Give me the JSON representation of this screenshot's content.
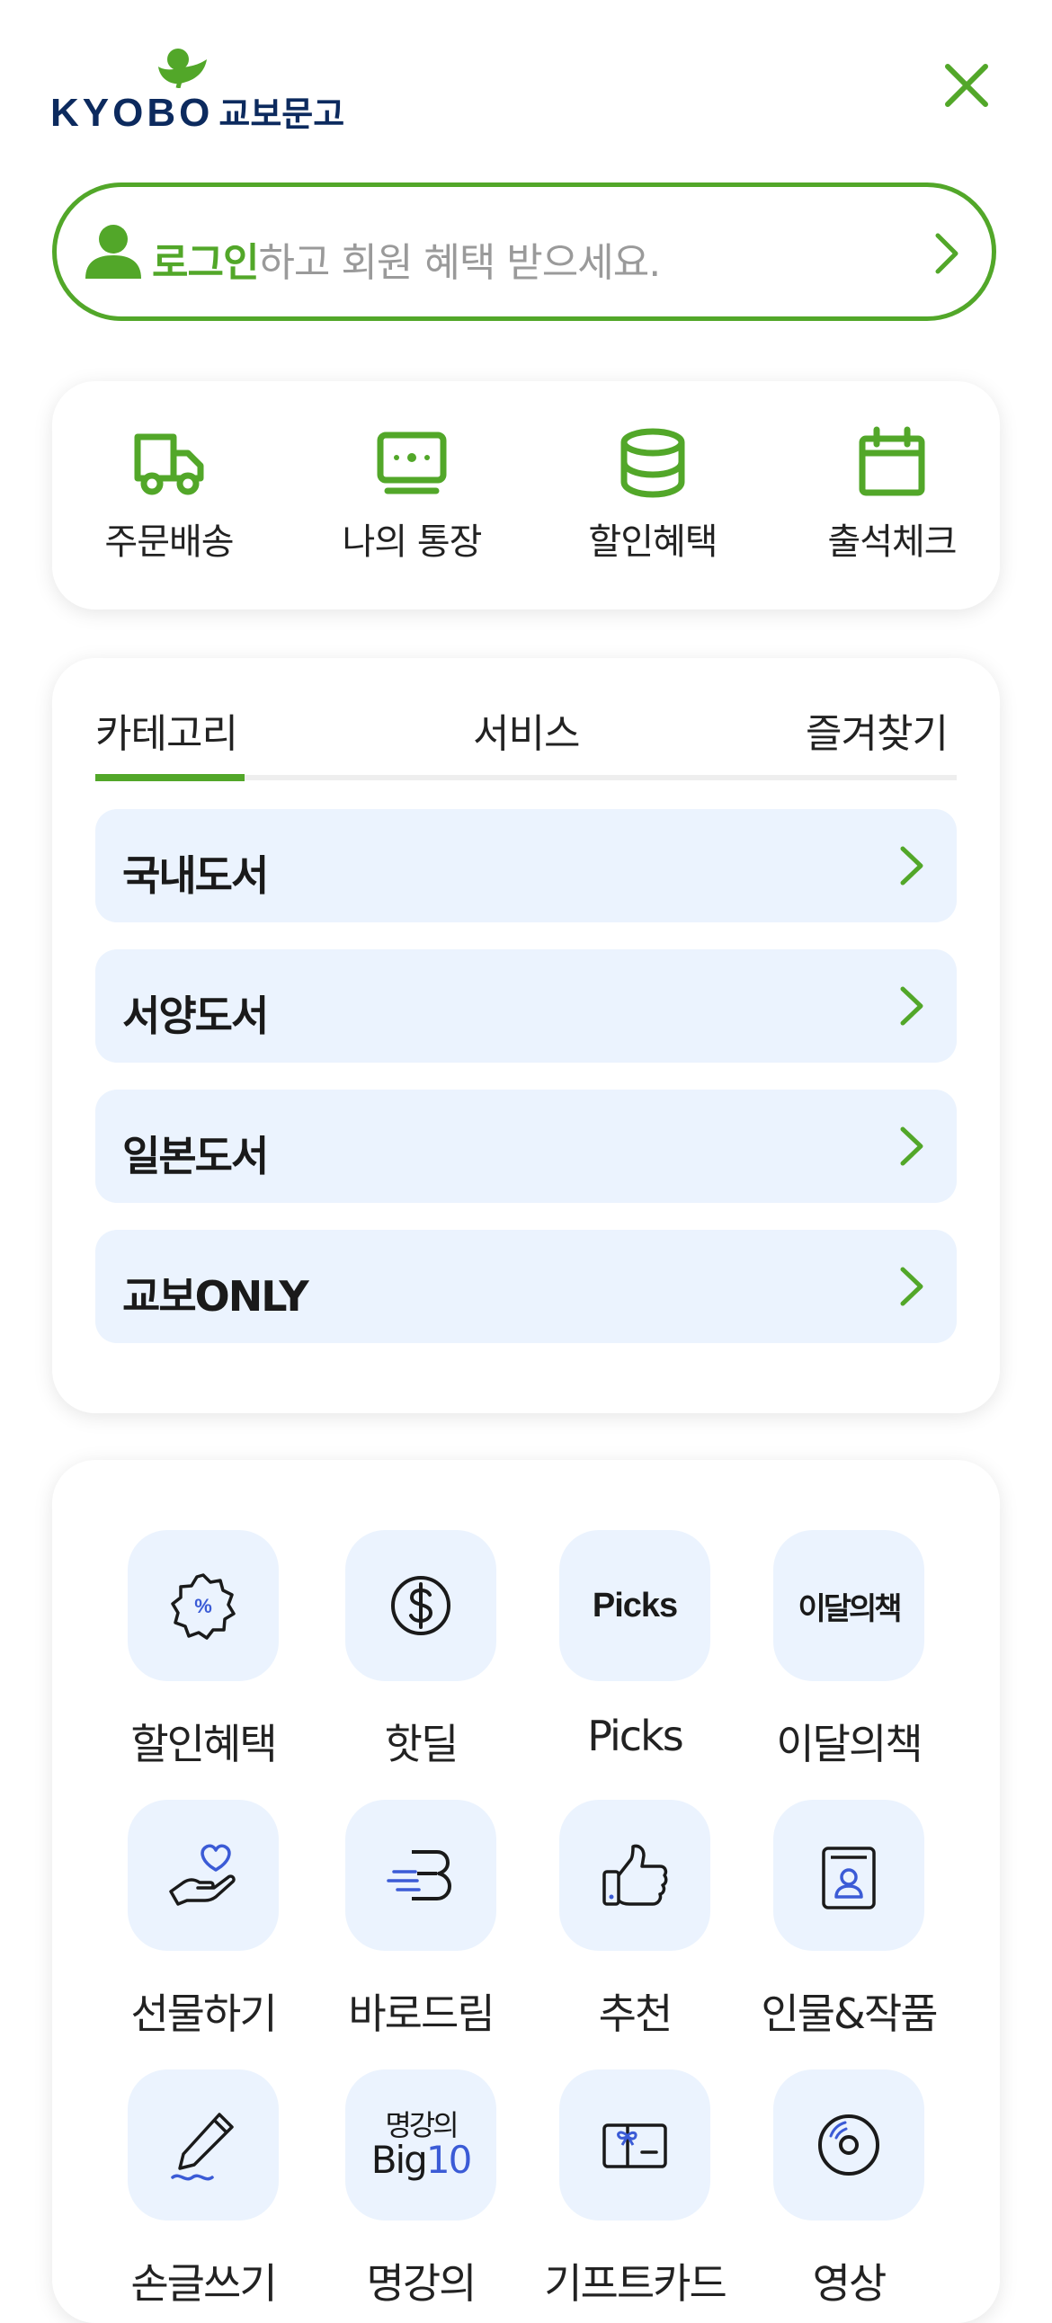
{
  "header": {
    "logo_en": "KYOBO",
    "logo_kr": "교보문고",
    "close_icon": "close-icon"
  },
  "login": {
    "highlight": "로그인",
    "rest": "하고 회원 혜택 받으세요."
  },
  "quick_menu": [
    {
      "label": "주문배송",
      "icon": "truck-icon"
    },
    {
      "label": "나의 통장",
      "icon": "passbook-icon"
    },
    {
      "label": "할인혜택",
      "icon": "coins-icon"
    },
    {
      "label": "출석체크",
      "icon": "calendar-icon"
    }
  ],
  "tabs": [
    {
      "label": "카테고리",
      "active": true
    },
    {
      "label": "서비스",
      "active": false
    },
    {
      "label": "즐겨찾기",
      "active": false
    }
  ],
  "categories": [
    "국내도서",
    "서양도서",
    "일본도서",
    "교보ONLY"
  ],
  "services": [
    {
      "label": "할인혜택",
      "icon": "discount-badge-icon"
    },
    {
      "label": "핫딜",
      "icon": "dollar-coin-icon"
    },
    {
      "label": "Picks",
      "icon_text": "Picks"
    },
    {
      "label": "이달의책",
      "icon_text": "이달의책"
    },
    {
      "label": "선물하기",
      "icon": "gift-hand-heart-icon"
    },
    {
      "label": "바로드림",
      "icon": "baro-dream-icon"
    },
    {
      "label": "추천",
      "icon": "thumbs-up-icon"
    },
    {
      "label": "인물&작품",
      "icon": "person-book-icon"
    },
    {
      "label": "손글쓰기",
      "icon": "pen-handwriting-icon"
    },
    {
      "label": "명강의",
      "icon_text_1": "명강의",
      "icon_text_2": "Big",
      "icon_text_3": "10"
    },
    {
      "label": "기프트카드",
      "icon": "gift-card-icon"
    },
    {
      "label": "영상",
      "icon": "disc-icon"
    }
  ],
  "colors": {
    "brand_green": "#52a729",
    "navy": "#0c2a5e",
    "category_bg": "#ebf3fe",
    "accent_blue": "#3b5bd6"
  }
}
